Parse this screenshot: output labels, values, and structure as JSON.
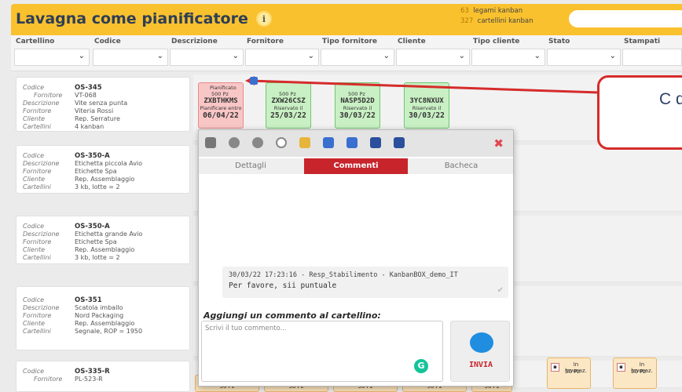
{
  "header": {
    "title": "Lavagna come pianificatore",
    "info_icon": "i",
    "counts": [
      {
        "n": "63",
        "label": "legami kanban"
      },
      {
        "n": "327",
        "label": "cartellini kanban"
      }
    ]
  },
  "filters": [
    "Cartellino",
    "Codice",
    "Descrizione",
    "Fornitore",
    "Tipo fornitore",
    "Cliente",
    "Tipo cliente",
    "Stato",
    "Stampati"
  ],
  "items": [
    {
      "rows": [
        [
          "Codice",
          "OS-345"
        ],
        [
          "Fornitore",
          "VT-068"
        ],
        [
          "Descrizione",
          "Vite senza punta"
        ],
        [
          "Fornitore",
          "Viteria Rossi"
        ],
        [
          "Cliente",
          "Rep. Serrature"
        ],
        [
          "Cartellini",
          "4 kanban"
        ]
      ]
    },
    {
      "rows": [
        [
          "Codice",
          "OS-350-A"
        ],
        [
          "Descrizione",
          "Etichetta piccola Avio"
        ],
        [
          "Fornitore",
          "Etichette Spa"
        ],
        [
          "Cliente",
          "Rep. Assemblaggio"
        ],
        [
          "Cartellini",
          "3 kb, lotte = 2"
        ]
      ]
    },
    {
      "rows": [
        [
          "Codice",
          "OS-350-A"
        ],
        [
          "Descrizione",
          "Etichetta grande Avio"
        ],
        [
          "Fornitore",
          "Etichette Spa"
        ],
        [
          "Cliente",
          "Rep. Assemblaggio"
        ],
        [
          "Cartellini",
          "3 kb, lotte = 2"
        ]
      ]
    },
    {
      "rows": [
        [
          "Codice",
          "OS-351"
        ],
        [
          "Descrizione",
          "Scatola imballo"
        ],
        [
          "Fornitore",
          "Nord Packaging"
        ],
        [
          "Cliente",
          "Rep. Assemblaggio"
        ],
        [
          "Cartellini",
          "Segnale, ROP = 1950"
        ]
      ]
    },
    {
      "rows": [
        [
          "Codice",
          "OS-335-R"
        ],
        [
          "Fornitore",
          "PL-523-R"
        ]
      ]
    }
  ],
  "kanbans": [
    {
      "top": "Pianificato",
      "qty": "500 Pz",
      "code": "ZXBTHKMS",
      "sub": "Pianificare entro",
      "date": "06/04/22",
      "color": "red"
    },
    {
      "top": "",
      "qty": "500 Pz",
      "code": "ZXW26CSZ",
      "sub": "Riservato il",
      "date": "25/03/22",
      "color": "green"
    },
    {
      "top": "",
      "qty": "500 Pz",
      "code": "NASP5D2D",
      "sub": "Riservato il",
      "date": "30/03/22",
      "color": "green"
    },
    {
      "top": "",
      "qty": "",
      "code": "3YC8NXUX",
      "sub": "Riservato il",
      "date": "30/03/22",
      "color": "green"
    }
  ],
  "bottom_cards": [
    "50 Pz",
    "50 Pz",
    "50 Pz",
    "50 Pz",
    "50 Pz"
  ],
  "progress_cards": [
    {
      "label": "In lavoraz.",
      "qty": "50 Pz"
    },
    {
      "label": "In lavoraz.",
      "qty": "50 Pz"
    }
  ],
  "popup": {
    "tabs": [
      "Dettagli",
      "Commenti",
      "Bacheca"
    ],
    "active_tab": "Commenti",
    "comment": {
      "meta": "30/03/22 17:23:16 - Resp_Stabilimento - KanbanBOX_demo_IT",
      "text": "Per favore, sii puntuale"
    },
    "new_label": "Aggiungi un commento al cartellino:",
    "placeholder": "Scrivi il tuo commento...",
    "send": "INVIA",
    "toolbar_icons": [
      "printer-icon",
      "block-icon",
      "pause-icon",
      "refresh-icon",
      "note-icon",
      "chart-icon",
      "calendar-icon",
      "save-icon",
      "image-icon"
    ]
  },
  "callout": {
    "text": "C que"
  },
  "colors": {
    "accent": "#c8242b",
    "header": "#f9c12e",
    "kanban_green": "#c9f0c4",
    "kanban_red": "#f9c6c6"
  }
}
